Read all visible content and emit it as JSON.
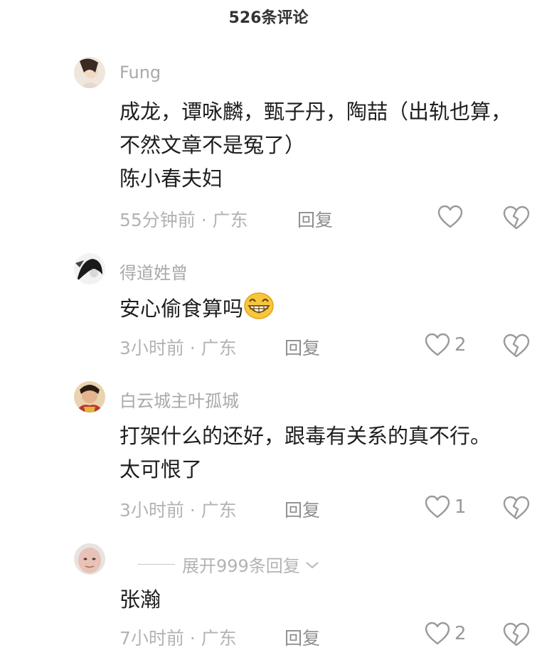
{
  "header": {
    "title": "526条评论"
  },
  "comments": [
    {
      "author": "Fung",
      "lines": [
        "成龙，谭咏麟，甄子丹，陶喆（出轨也算，",
        "不然文章不是冤了）",
        "陈小春夫妇"
      ],
      "time": "55分钟前 · 广东",
      "reply_label": "回复",
      "likes": ""
    },
    {
      "author": "得道姓曾",
      "lines": [
        "安心偷食算吗"
      ],
      "emoji": "grin-emoji",
      "time": "3小时前 · 广东",
      "reply_label": "回复",
      "likes": "2"
    },
    {
      "author": "白云城主叶孤城",
      "lines": [
        "打架什么的还好，跟毒有关系的真不行。",
        "太可恨了"
      ],
      "time": "3小时前 · 广东",
      "reply_label": "回复",
      "likes": "1"
    },
    {
      "author": "",
      "lines": [
        "张瀚"
      ],
      "time": "7小时前 · 广东",
      "reply_label": "回复",
      "likes": "2"
    }
  ],
  "expand_replies": {
    "label": "展开999条回复"
  },
  "icons": {
    "like": "heart-outline-icon",
    "dislike": "broken-heart-icon",
    "expand": "chevron-down-icon"
  }
}
